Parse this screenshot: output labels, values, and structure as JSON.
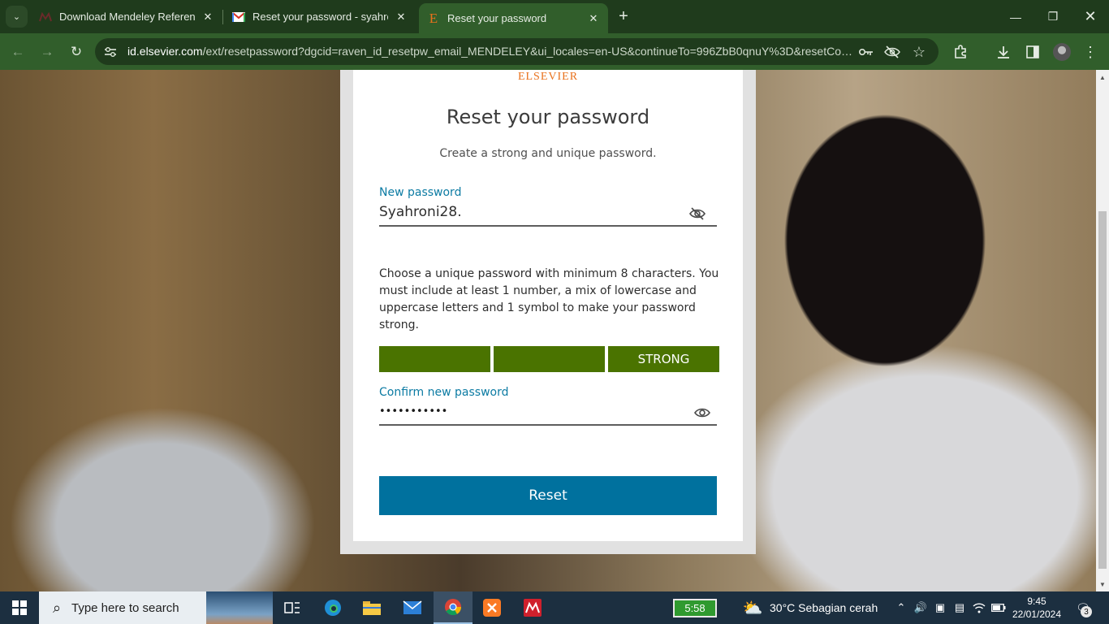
{
  "browser": {
    "tabs": [
      {
        "title": "Download Mendeley Reference",
        "favicon": "mendeley-icon",
        "active": false
      },
      {
        "title": "Reset your password - syahroon",
        "favicon": "gmail-icon",
        "active": false
      },
      {
        "title": "Reset your password",
        "favicon": "elsevier-icon",
        "favicon_glyph": "E",
        "active": true
      }
    ],
    "url_domain": "id.elsevier.com",
    "url_path": "/ext/resetpassword?dgcid=raven_id_resetpw_email_MENDELEY&ui_locales=en-US&continueTo=996ZbB0qnuY%3D&resetCode=..."
  },
  "page": {
    "brand": "ELSEVIER",
    "title": "Reset your password",
    "subtitle": "Create a strong and unique password.",
    "new_password": {
      "label": "New password",
      "value": "Syahroni28."
    },
    "hint": "Choose a unique password with minimum 8 characters. You must include at least 1 number, a mix of lowercase and uppercase letters and 1 symbol to make your password strong.",
    "strength": {
      "label": "STRONG",
      "filled_segments": 3,
      "total_segments": 3,
      "color": "#4a7300"
    },
    "confirm_password": {
      "label": "Confirm new password",
      "masked_value": "•••••••••••"
    },
    "reset_label": "Reset",
    "colors": {
      "brand": "#e9711c",
      "accent": "#00719e",
      "label": "#0c7ba3"
    }
  },
  "taskbar": {
    "search_placeholder": "Type here to search",
    "battery_time": "5:58",
    "weather": "30°C  Sebagian cerah",
    "time": "9:45",
    "date": "22/01/2024",
    "notification_count": "3"
  }
}
